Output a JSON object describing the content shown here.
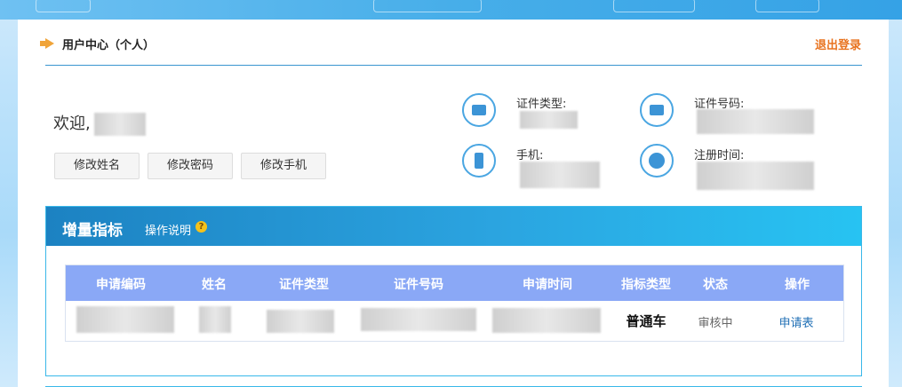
{
  "header": {
    "title": "用户中心（个人）",
    "logout": "退出登录"
  },
  "profile": {
    "welcome": "欢迎,",
    "buttons": [
      "修改姓名",
      "修改密码",
      "修改手机"
    ]
  },
  "info": {
    "id_type_label": "证件类型:",
    "id_number_label": "证件号码:",
    "phone_label": "手机:",
    "register_time_label": "注册时间:"
  },
  "section": {
    "title": "增量指标",
    "help": "操作说明",
    "help_icon": "?"
  },
  "table": {
    "headers": [
      "申请编码",
      "姓名",
      "证件类型",
      "证件号码",
      "申请时间",
      "指标类型",
      "状态",
      "操作"
    ],
    "row": {
      "indicator_type": "普通车",
      "status": "审核中",
      "action": "申请表"
    }
  },
  "colors": {
    "accent": "#e8731f",
    "section_head": "#1c82c2",
    "table_head": "#8aa8f6",
    "action_link": "#1f6fb5"
  }
}
